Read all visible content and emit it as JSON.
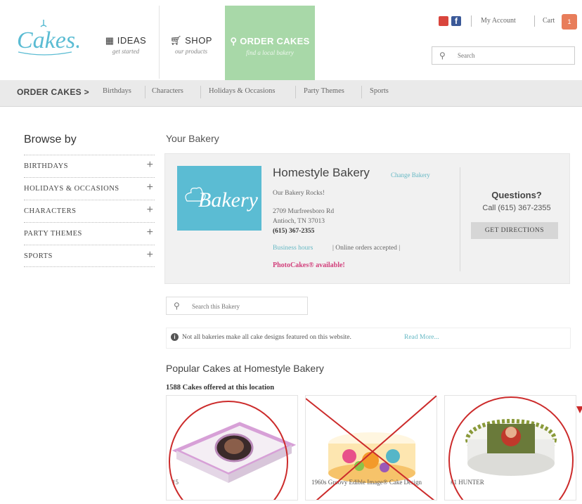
{
  "header": {
    "logo_text": "Cakes.com",
    "nav": [
      {
        "label": "IDEAS",
        "sub": "get started",
        "icon": "grid-icon"
      },
      {
        "label": "SHOP",
        "sub": "our products",
        "icon": "cart-icon"
      },
      {
        "label": "ORDER CAKES",
        "sub": "find a local bakery",
        "icon": "pin-icon",
        "active": true
      }
    ],
    "my_account": "My Account",
    "cart": "Cart",
    "cart_count": "1",
    "search_placeholder": "Search"
  },
  "category_bar": {
    "title": "ORDER CAKES >",
    "links": [
      "Birthdays",
      "Characters",
      "Holidays & Occasions",
      "Party Themes",
      "Sports"
    ]
  },
  "sidebar": {
    "title": "Browse by",
    "items": [
      "BIRTHDAYS",
      "HOLIDAYS & OCCASIONS",
      "CHARACTERS",
      "PARTY THEMES",
      "SPORTS"
    ]
  },
  "bakery": {
    "heading": "Your Bakery",
    "logo_text": "Bakery",
    "name": "Homestyle Bakery",
    "change_link": "Change Bakery",
    "tagline": "Our Bakery Rocks!",
    "address1": "2709 Murfreesboro Rd",
    "address2": "Antioch, TN 37013",
    "phone": "(615) 367-2355",
    "hours_link": "Business hours",
    "online": "| Online orders accepted |",
    "photocakes": "PhotoCakes® available!",
    "questions_title": "Questions?",
    "questions_call": "Call (615) 367-2355",
    "directions_button": "GET DIRECTIONS"
  },
  "bakery_search_placeholder": "Search this Bakery",
  "notice": {
    "text": "Not all bakeries make all cake designs featured on this website.",
    "read_more": "Read More..."
  },
  "popular": {
    "title": "Popular Cakes at Homestyle Bakery",
    "count": "1588 Cakes offered at this location",
    "cards": [
      {
        "caption": "15"
      },
      {
        "caption": "1960s Groovy Edible Image® Cake Design"
      },
      {
        "caption": "#1 HUNTER"
      }
    ]
  },
  "colors": {
    "order_tab": "#a8d8a8",
    "bakery_logo_bg": "#5bbcd3",
    "link": "#66b8c4",
    "photocakes": "#d23f7b",
    "annotation_red": "#cc2b2b"
  }
}
